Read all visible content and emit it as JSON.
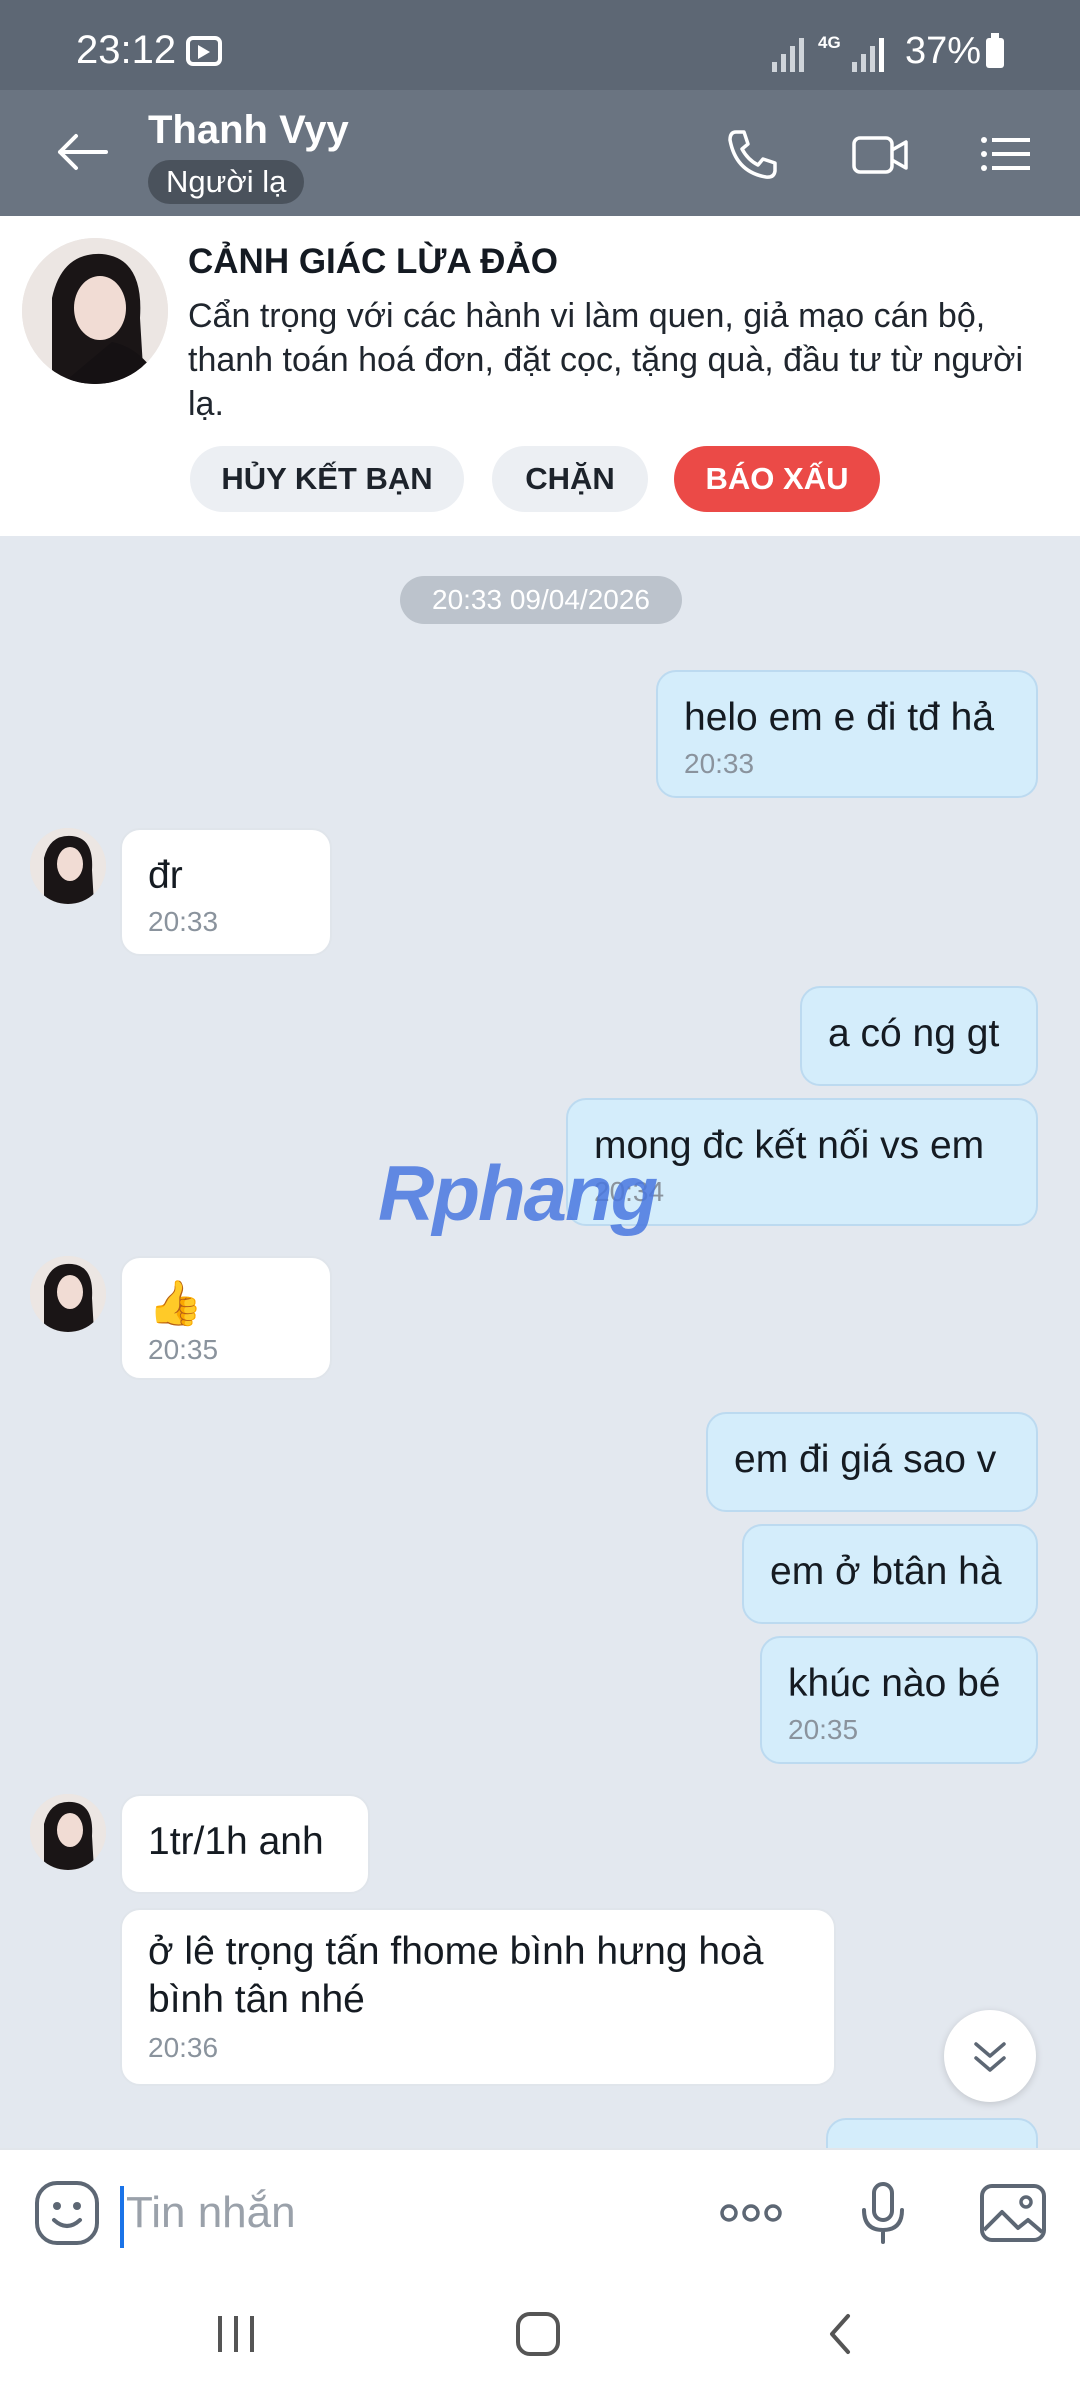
{
  "status_bar": {
    "time": "23:12",
    "network": "4G",
    "battery": "37%",
    "icons": [
      "cast-icon",
      "signal-icon",
      "battery-icon"
    ]
  },
  "header": {
    "contact_name": "Thanh Vyy",
    "badge": "Người lạ",
    "icons": [
      "back-arrow-icon",
      "phone-icon",
      "video-call-icon",
      "menu-icon"
    ]
  },
  "warning": {
    "title": "CẢNH GIÁC LỪA ĐẢO",
    "text": "Cẩn trọng với các hành vi làm quen, giả mạo cán bộ, thanh toán hoá đơn, đặt cọc, tặng quà, đầu tư từ người lạ.",
    "buttons": {
      "unfriend": "HỦY KẾT BẠN",
      "block": "CHẶN",
      "report": "BÁO XẤU"
    },
    "colors": {
      "report": "#eb4a47"
    }
  },
  "chat": {
    "date_divider": "20:33 09/04/2026",
    "messages": [
      {
        "text": "helo em e đi tđ hả",
        "time": "20:33"
      },
      {
        "text": "đr",
        "time": "20:33"
      },
      {
        "text": "a có ng gt"
      },
      {
        "text": "mong đc kết nối vs em",
        "time": "20:34"
      },
      {
        "text": "👍",
        "time": "20:35"
      },
      {
        "text": "em đi giá sao v"
      },
      {
        "text": "em ở btân hà"
      },
      {
        "text": "khúc nào bé",
        "time": "20:35"
      },
      {
        "text": "1tr/1h anh"
      },
      {
        "text": "ở lê trọng tấn fhome bình hưng hoà bình tân nhé",
        "time": "20:36"
      }
    ],
    "watermark": "Rphang",
    "colors": {
      "outgoing": "#d4edfb",
      "incoming": "#ffffff"
    }
  },
  "input_bar": {
    "placeholder": "Tin nhắn",
    "icons": [
      "emoji-icon",
      "more-icon",
      "microphone-icon",
      "image-icon"
    ]
  },
  "nav_bar": {
    "icons": [
      "recent-apps-icon",
      "home-icon",
      "back-icon"
    ]
  }
}
